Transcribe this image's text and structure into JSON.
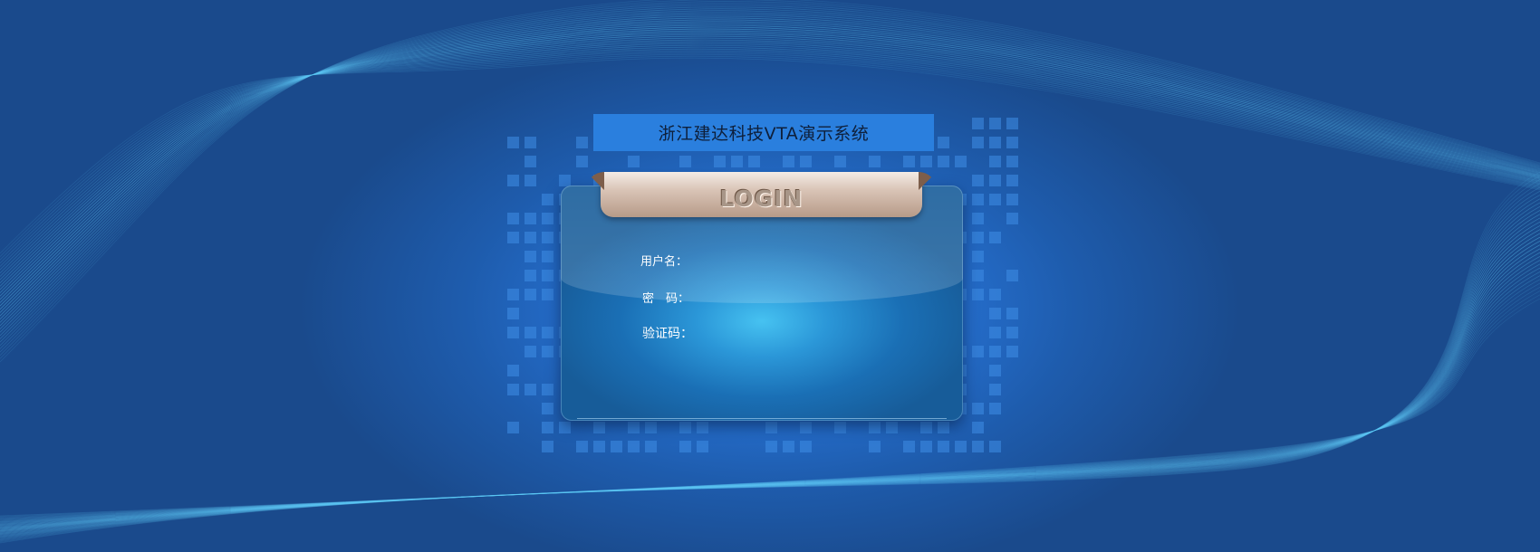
{
  "app": {
    "title": "浙江建达科技VTA演示系统"
  },
  "login_panel": {
    "header_label": "LOGIN",
    "fields": {
      "username_label": "用户名：",
      "password_label": "密　码：",
      "captcha_label": "验证码："
    }
  },
  "colors": {
    "background_dark": "#1a4a8c",
    "background_light": "#2f86e4",
    "title_bar": "#2a7fde",
    "card_center": "#46c2f1",
    "card_edge": "#175c99",
    "tab_light": "#f4ece6",
    "tab_dark": "#b69a88"
  }
}
